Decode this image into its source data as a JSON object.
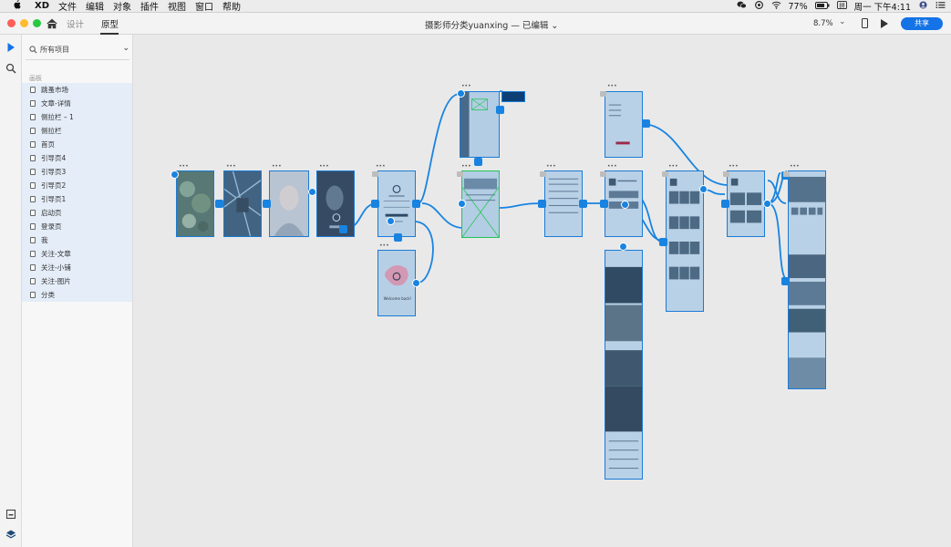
{
  "menubar": {
    "apple": "",
    "app_name": "XD",
    "items": [
      "文件",
      "编辑",
      "对象",
      "插件",
      "视图",
      "窗口",
      "帮助"
    ],
    "battery": "77%",
    "datetime": "周一 下午4:11"
  },
  "titlebar": {
    "tab_design": "设计",
    "tab_prototype": "原型",
    "document_title": "摄影师分类yuanxing — 已编辑",
    "zoom": "8.7%",
    "share_label": "共享"
  },
  "panel": {
    "search_placeholder": "所有项目",
    "section_label": "画板",
    "boards": [
      "跳蚤市场",
      "文章-详情",
      "侧拉栏 – 1",
      "侧拉栏",
      "首页",
      "引导页4",
      "引导页3",
      "引导页2",
      "引导页1",
      "启动页",
      "登录页",
      "我",
      "关注-文章",
      "关注-小铺",
      "关注-图片",
      "分类"
    ]
  },
  "colors": {
    "accent": "#1473e6",
    "wire": "#1883e0",
    "selected_green": "#23c552",
    "canvas": "#e9e9e9"
  },
  "canvas": {
    "welcome_text": "Welcome back!"
  }
}
